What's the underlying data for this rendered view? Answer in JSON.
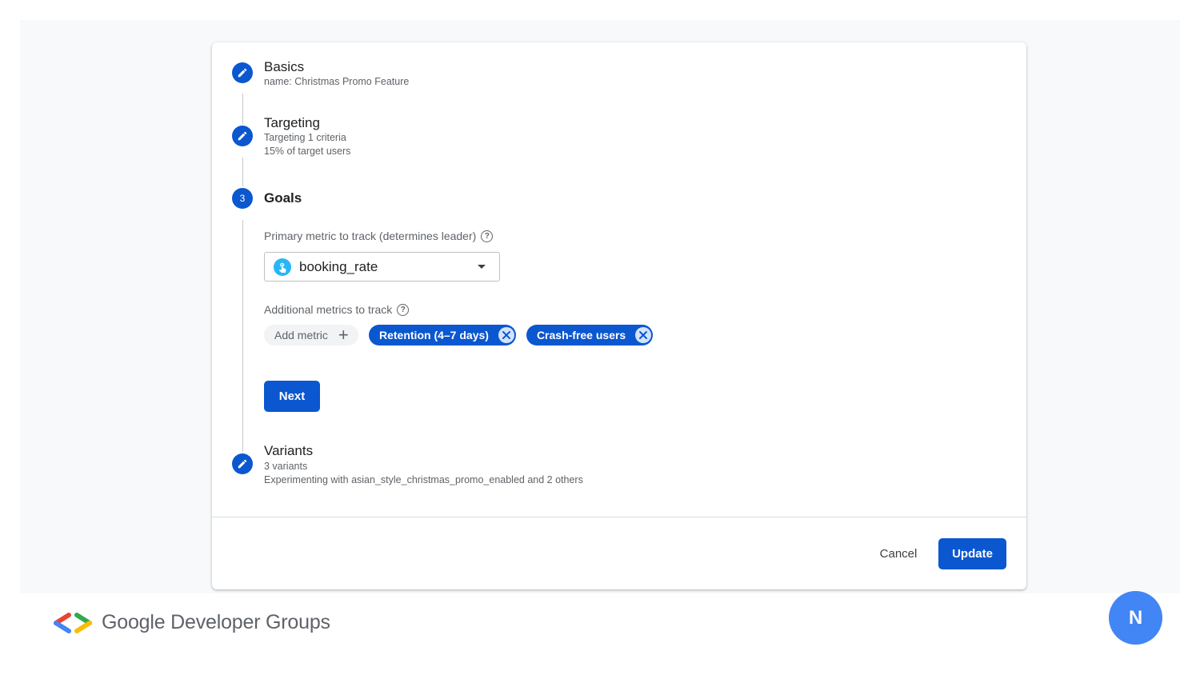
{
  "steps": [
    {
      "title": "Basics",
      "subtitles": [
        "name: Christmas Promo Feature"
      ],
      "icon": "pencil-icon"
    },
    {
      "title": "Targeting",
      "subtitles": [
        "Targeting 1 criteria",
        "15% of target users"
      ],
      "icon": "pencil-icon"
    },
    {
      "title": "Goals",
      "number": "3",
      "active": true
    },
    {
      "title": "Variants",
      "subtitles": [
        "3 variants",
        "Experimenting with asian_style_christmas_promo_enabled and 2 others"
      ],
      "icon": "pencil-icon"
    }
  ],
  "goals": {
    "primary_label": "Primary metric to track (determines leader)",
    "primary_value": "booking_rate",
    "additional_label": "Additional metrics to track",
    "add_metric_label": "Add metric",
    "chips": [
      "Retention (4–7 days)",
      "Crash-free users"
    ],
    "next_label": "Next"
  },
  "actions": {
    "cancel_label": "Cancel",
    "update_label": "Update"
  },
  "footer": {
    "brand": "Google Developer Groups",
    "avatar_letter": "N"
  },
  "colors": {
    "accent": "#0b57d0",
    "chip_close_bg": "#d3e3fd",
    "avatar": "#4285f4"
  }
}
